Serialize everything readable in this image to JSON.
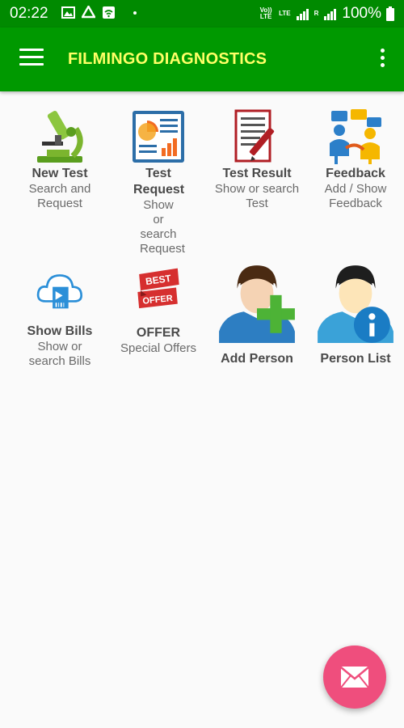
{
  "status_bar": {
    "time": "02:22",
    "volte_label": "Vo)) LTE",
    "lte_label": "LTE",
    "roaming_label": "R",
    "battery": "100%"
  },
  "app_bar": {
    "title": "FILMINGO DIAGNOSTICS"
  },
  "tiles": [
    {
      "label": "New Test",
      "subtitle": "Search and Request",
      "icon": "microscope-icon"
    },
    {
      "label": "Test Request",
      "subtitle": "Show or search Request",
      "icon": "report-chart-icon"
    },
    {
      "label": "Test Result",
      "subtitle": "Show or search Test",
      "icon": "document-pen-icon"
    },
    {
      "label": "Feedback",
      "subtitle": "Add / Show Feedback",
      "icon": "people-chat-icon"
    },
    {
      "label": "Show Bills",
      "subtitle": "Show or search Bills",
      "icon": "cloud-bill-icon"
    },
    {
      "label": "OFFER",
      "subtitle": "Special Offers",
      "icon": "best-offer-icon",
      "badge_top": "BEST",
      "badge_bottom": "OFFER"
    },
    {
      "label": "Add Person",
      "subtitle": "",
      "icon": "add-person-icon"
    },
    {
      "label": "Person List",
      "subtitle": "",
      "icon": "person-info-icon"
    }
  ],
  "fab": {
    "icon": "mail-icon"
  },
  "colors": {
    "status_bar": "#008a00",
    "app_bar": "#009900",
    "title_text": "#ffff66",
    "fab": "#ef4e7d"
  }
}
